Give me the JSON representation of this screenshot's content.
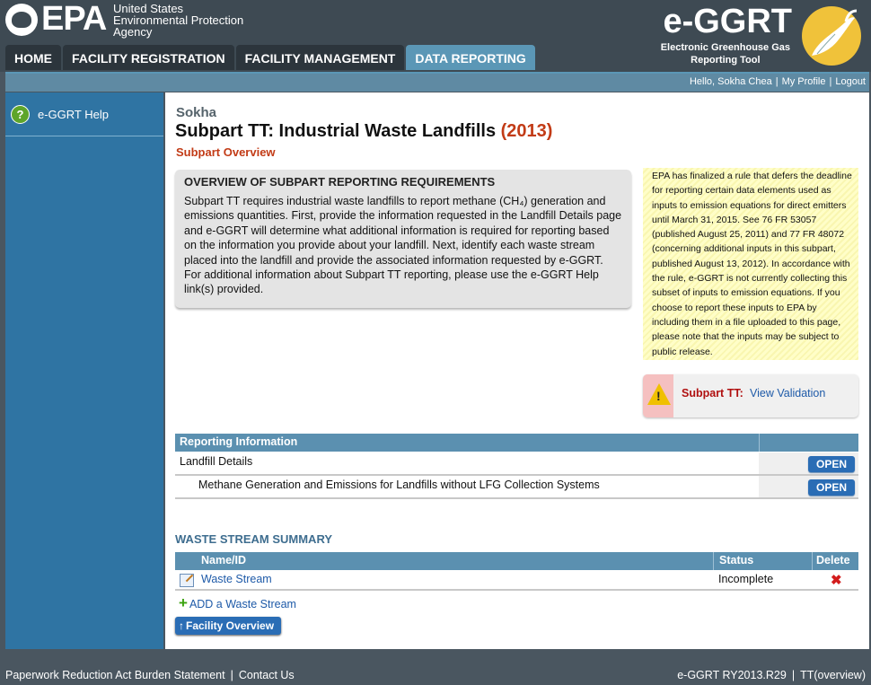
{
  "header": {
    "agency_short": "EPA",
    "agency_lines": [
      "United States",
      "Environmental Protection",
      "Agency"
    ],
    "app_title": "e-GGRT",
    "app_subtitle_lines": [
      "Electronic Greenhouse Gas",
      "Reporting Tool"
    ]
  },
  "nav": {
    "tabs": [
      {
        "label": "HOME",
        "active": false
      },
      {
        "label": "FACILITY REGISTRATION",
        "active": false
      },
      {
        "label": "FACILITY MANAGEMENT",
        "active": false
      },
      {
        "label": "DATA REPORTING",
        "active": true
      }
    ]
  },
  "userbar": {
    "greeting": "Hello, Sokha Chea",
    "profile": "My Profile",
    "logout": "Logout"
  },
  "sidebar": {
    "help_label": "e-GGRT Help"
  },
  "main": {
    "facility": "Sokha",
    "title": "Subpart TT: Industrial Waste Landfills",
    "year": "(2013)",
    "subtitle": "Subpart Overview",
    "overview_heading": "OVERVIEW OF SUBPART REPORTING REQUIREMENTS",
    "overview_text": "Subpart TT requires industrial waste landfills to report methane (CH₄) generation and emissions quantities. First, provide the information requested in the Landfill Details page and e-GGRT will determine what additional information is required for reporting based on the information you provide about your landfill. Next, identify each waste stream placed into the landfill and provide the associated information requested by e-GGRT. For additional information about Subpart TT reporting, please use the e-GGRT Help link(s) provided.",
    "notice_text": "EPA has finalized a rule that defers the deadline for reporting certain data elements used as inputs to emission equations for direct emitters until March 31, 2015. See 76 FR 53057 (published August 25, 2011) and 77 FR 48072 (concerning additional inputs in this subpart, published August 13, 2012). In accordance with the rule, e-GGRT is not currently collecting this subset of inputs to emission equations. If you choose to report these inputs to EPA by including them in a file uploaded to this page, please note that the inputs may be subject to public release.",
    "validation_label": "Subpart TT:",
    "validation_link": "View Validation"
  },
  "reporting": {
    "header": "Reporting Information",
    "rows": [
      {
        "label": "Landfill Details",
        "button": "OPEN"
      },
      {
        "label": "Methane Generation and Emissions for Landfills without LFG Collection Systems",
        "button": "OPEN"
      }
    ]
  },
  "waste_stream": {
    "heading": "WASTE STREAM SUMMARY",
    "columns": [
      "Name/ID",
      "Status",
      "Delete"
    ],
    "rows": [
      {
        "name": "Waste Stream",
        "status": "Incomplete",
        "delete": "✖"
      }
    ],
    "add_label": "ADD a Waste Stream",
    "facility_overview_button": "Facility Overview"
  },
  "footer": {
    "paperwork": "Paperwork Reduction Act Burden Statement",
    "contact": "Contact Us",
    "version": "e-GGRT RY2013.R29",
    "page_code": "TT(overview)"
  }
}
